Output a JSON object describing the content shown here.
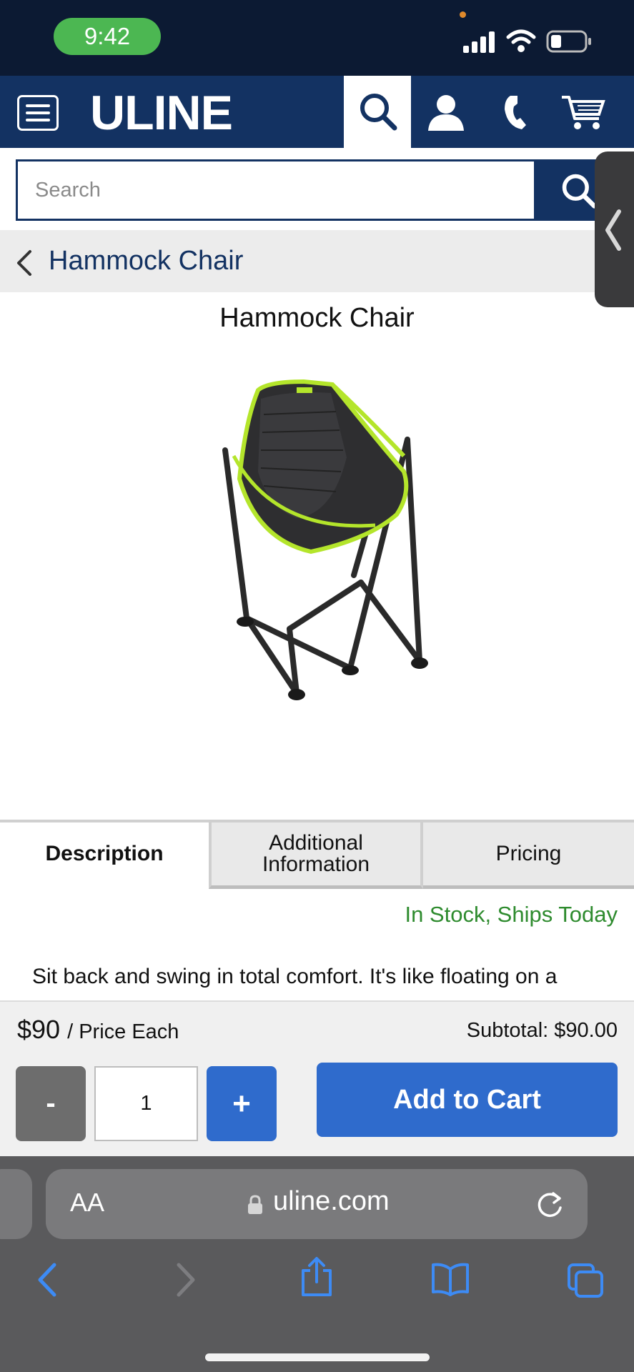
{
  "status_bar": {
    "time": "9:42"
  },
  "header": {
    "logo": "ULINE"
  },
  "search": {
    "placeholder": "Search"
  },
  "breadcrumb": {
    "label": "Hammock Chair"
  },
  "product": {
    "title": "Hammock Chair",
    "tabs": [
      {
        "label": "Description",
        "active": true
      },
      {
        "label": "Additional Information",
        "active": false
      },
      {
        "label": "Pricing",
        "active": false
      }
    ],
    "stock_status": "In Stock, Ships Today",
    "description": "Sit back and swing in total comfort. It's like floating on a cloud."
  },
  "cart_bar": {
    "price": "$90",
    "price_unit": "/ Price Each",
    "subtotal": "Subtotal: $90.00",
    "minus_label": "-",
    "quantity": "1",
    "plus_label": "+",
    "add_to_cart": "Add to Cart"
  },
  "browser": {
    "text_size_label": "AA",
    "url": "uline.com"
  },
  "colors": {
    "brand_navy": "#133262",
    "action_blue": "#2f6bcc",
    "stock_green": "#2e8b2e",
    "status_pill_green": "#4cb752"
  }
}
